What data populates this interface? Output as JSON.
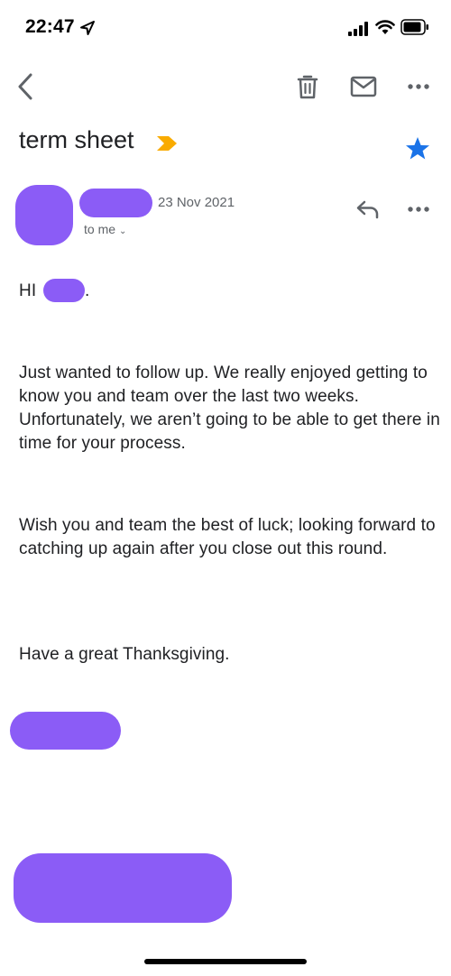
{
  "status_bar": {
    "time": "22:47",
    "icons": [
      "location-arrow-icon",
      "cellular-signal-icon",
      "wifi-icon",
      "battery-icon"
    ]
  },
  "toolbar": {
    "icons": [
      "back-chevron-icon",
      "trash-icon",
      "mail-icon",
      "more-horizontal-icon"
    ]
  },
  "email": {
    "subject": "term sheet",
    "important_marker_color": "#f9ab00",
    "starred": true,
    "star_color": "#1a73e8",
    "date": "23 Nov 2021",
    "recipient_label": "to me",
    "recipient_chevron": "⌄",
    "greeting_prefix": "HI",
    "greeting_suffix": ".",
    "paragraphs": [
      "Just wanted to follow up.  We really enjoyed getting to know you and team over the last two weeks.  Unfortunately, we aren’t going to be able to get there in time for your process.",
      "Wish you and team the best of luck; looking forward to catching up again after you close out this round.",
      "Have a great Thanksgiving."
    ]
  },
  "colors": {
    "redaction": "#8b5cf6",
    "text_primary": "#202124",
    "text_secondary": "#5f6368",
    "icon_gray": "#5f6368"
  }
}
